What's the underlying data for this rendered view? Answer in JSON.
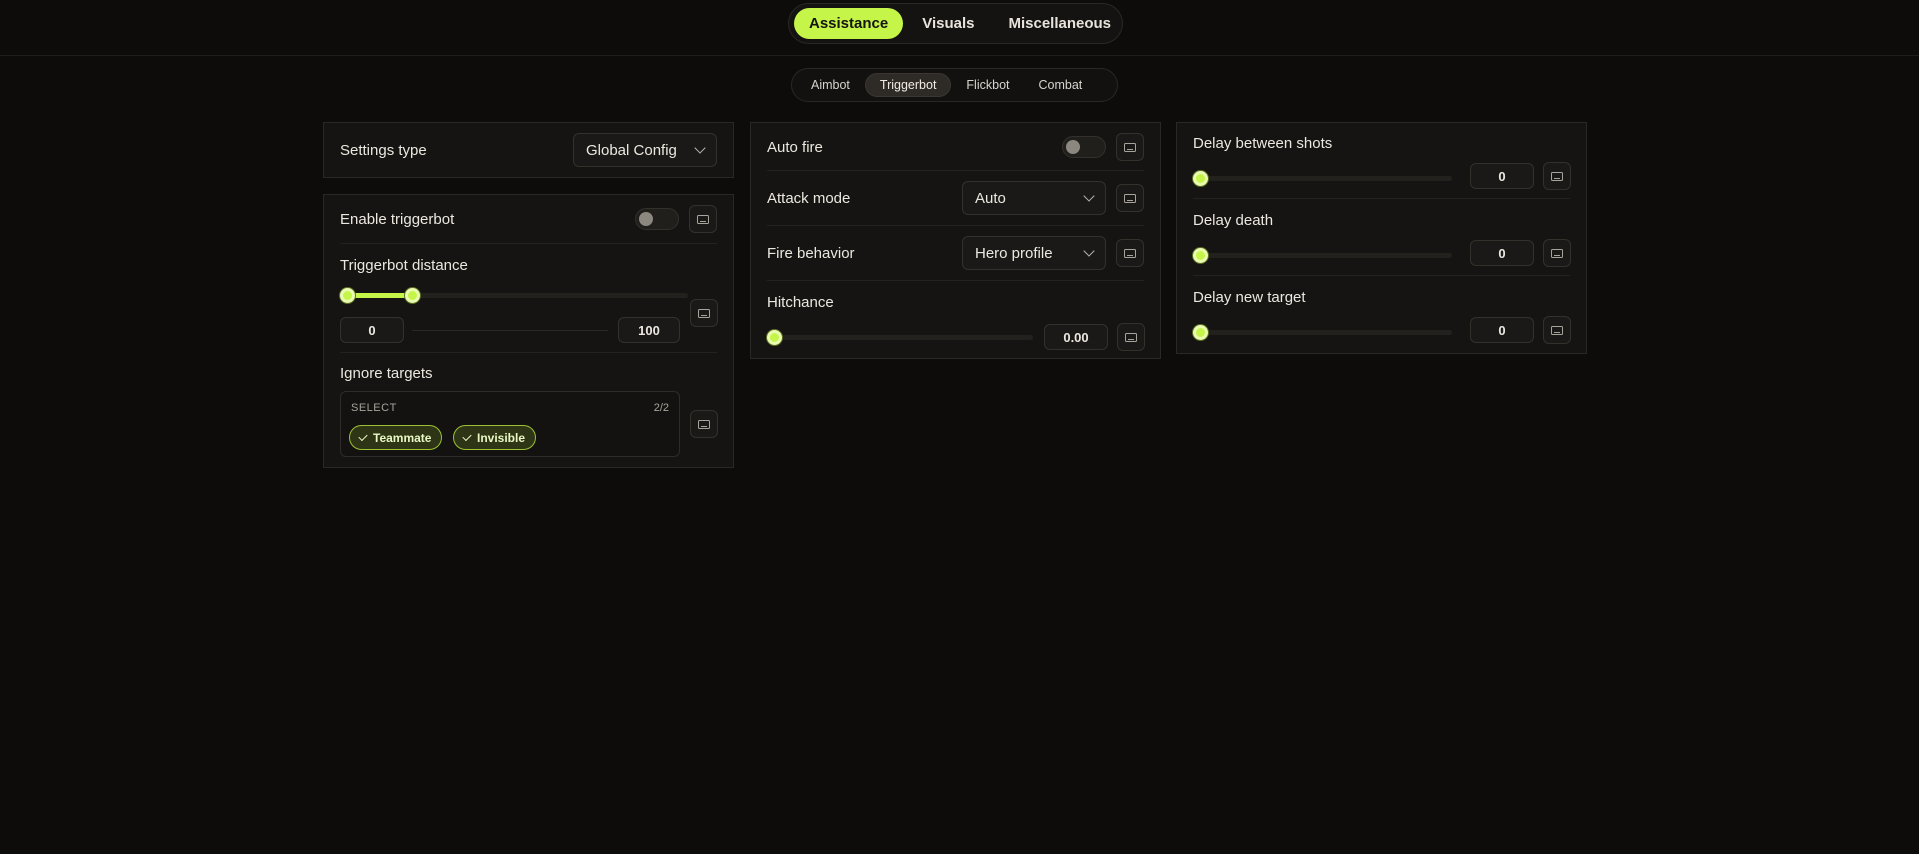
{
  "nav": {
    "tabs": [
      {
        "label": "Assistance",
        "active": true
      },
      {
        "label": "Visuals",
        "active": false
      },
      {
        "label": "Miscellaneous",
        "active": false
      }
    ]
  },
  "subnav": {
    "tabs": [
      {
        "label": "Aimbot",
        "active": false
      },
      {
        "label": "Triggerbot",
        "active": true
      },
      {
        "label": "Flickbot",
        "active": false
      },
      {
        "label": "Combat",
        "active": false
      }
    ]
  },
  "settings": {
    "label": "Settings type",
    "value": "Global Config"
  },
  "triggerbot": {
    "enable_label": "Enable triggerbot",
    "enabled": false,
    "distance": {
      "label": "Triggerbot distance",
      "min": "0",
      "max": "100",
      "range_fraction": [
        0,
        0.19
      ]
    },
    "ignore": {
      "label": "Ignore targets",
      "select_label": "SELECT",
      "count": "2/2",
      "chips": [
        "Teammate",
        "Invisible"
      ]
    }
  },
  "fire": {
    "auto_fire_label": "Auto fire",
    "auto_fire": false,
    "attack_mode": {
      "label": "Attack mode",
      "value": "Auto"
    },
    "fire_behavior": {
      "label": "Fire behavior",
      "value": "Hero profile"
    },
    "hitchance": {
      "label": "Hitchance",
      "value": "0.00",
      "fraction": 0
    }
  },
  "delays": {
    "between_shots": {
      "label": "Delay between shots",
      "value": "0",
      "fraction": 0
    },
    "death": {
      "label": "Delay death",
      "value": "0",
      "fraction": 0
    },
    "new_target": {
      "label": "Delay new target",
      "value": "0",
      "fraction": 0
    }
  },
  "colors": {
    "accent": "#c6f54a",
    "background": "#0d0c0a",
    "panel": "#151412"
  },
  "icons": {
    "keybind": "keyboard-icon",
    "dropdown": "chevron-down-icon",
    "chip_check": "check-icon"
  }
}
